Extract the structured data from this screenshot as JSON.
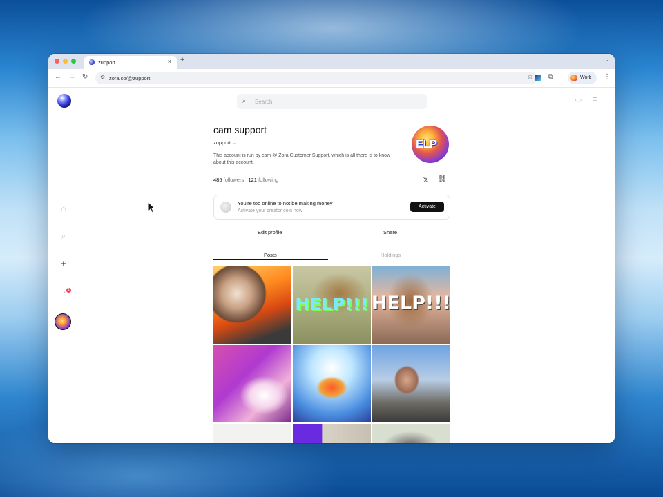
{
  "browser": {
    "tab_title": "zupport",
    "tab_close": "×",
    "new_tab": "+",
    "url": "zora.co/@zupport",
    "profile_label": "Work"
  },
  "site": {
    "search_placeholder": "Search"
  },
  "profile": {
    "name": "cam support",
    "handle": "zupport",
    "handle_chevron": "⌄",
    "bio": "This account is run by cam @ Zora Customer Support, which is all there is to know about this account.",
    "avatar_text": "ELP",
    "followers_count": "485",
    "followers_label": "followers",
    "following_count": "121",
    "following_label": "following",
    "x_icon_glyph": "𝕏"
  },
  "promo": {
    "title": "You're too online to not be making money",
    "subtitle": "Activate your creator coin now",
    "button": "Activate"
  },
  "actions": {
    "edit_profile": "Edit profile",
    "share": "Share"
  },
  "tabs": [
    {
      "label": "Posts",
      "active": true
    },
    {
      "label": "Holdings",
      "active": false
    }
  ],
  "posts": [
    {
      "overlay": "",
      "icon": "man-fire-image"
    },
    {
      "overlay": "HELP!!!",
      "icon": "capybara-help-image"
    },
    {
      "overlay": "HELP!!!",
      "icon": "capybara-help-image"
    },
    {
      "overlay": "",
      "icon": "pink-abstract-image"
    },
    {
      "overlay": "",
      "icon": "butterfly-image"
    },
    {
      "overlay": "",
      "icon": "man-suit-help-image"
    }
  ],
  "colors": {
    "accent_dark": "#111111",
    "notification_badge": "#ff3b4d"
  }
}
